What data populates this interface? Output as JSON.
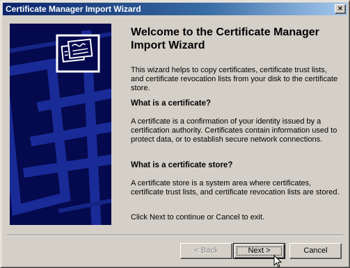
{
  "window": {
    "title": "Certificate Manager Import Wizard",
    "close_symbol": "×"
  },
  "side_panel": {
    "icon": "certificate-icon",
    "background_color": "#05094d",
    "pattern_color": "#1c2fa0"
  },
  "main": {
    "heading": "Welcome to the Certificate Manager Import Wizard",
    "intro": "This wizard helps to copy certificates, certificate trust lists, and certificate revocation lists from your disk to the certificate store.",
    "sections": [
      {
        "title": "What is a certificate?",
        "body": "A certificate is a confirmation of your identity issued by a certification authority.  Certificates contain information used to protect data, or to establish secure network connections."
      },
      {
        "title": "What is a certificate store?",
        "body": "A certificate store is a system area where certificates, certificate trust lists, and certificate revocation lists are stored."
      }
    ],
    "footer_text": "Click Next to continue or Cancel to exit."
  },
  "buttons": {
    "back": {
      "label": "< Back",
      "enabled": false
    },
    "next": {
      "label": "Next >",
      "enabled": true,
      "default": true
    },
    "cancel": {
      "label": "Cancel",
      "enabled": true
    }
  },
  "cursor": {
    "icon": "arrow-cursor-icon"
  }
}
